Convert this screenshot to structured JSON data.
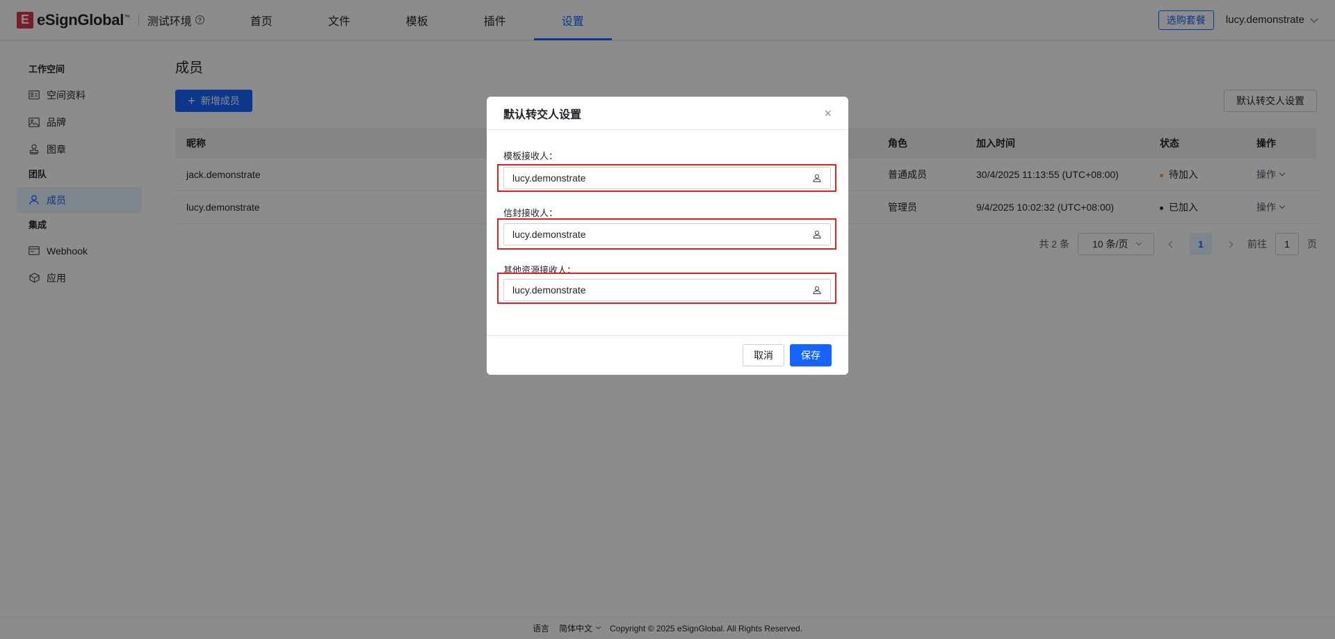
{
  "header": {
    "logo_mark": "E",
    "logo_text": "eSignGlobal",
    "logo_tm": "™",
    "env_label": "测试环境",
    "nav": [
      {
        "label": "首页",
        "active": false
      },
      {
        "label": "文件",
        "active": false
      },
      {
        "label": "模板",
        "active": false
      },
      {
        "label": "插件",
        "active": false
      },
      {
        "label": "设置",
        "active": true
      }
    ],
    "buy_label": "选购套餐",
    "user_name": "lucy.demonstrate"
  },
  "sidebar": {
    "groups": [
      {
        "title": "工作空间",
        "items": [
          {
            "label": "空间资料",
            "icon": "id-card-icon"
          },
          {
            "label": "品牌",
            "icon": "image-icon"
          },
          {
            "label": "图章",
            "icon": "stamp-icon"
          }
        ]
      },
      {
        "title": "团队",
        "items": [
          {
            "label": "成员",
            "icon": "user-icon",
            "active": true
          }
        ]
      },
      {
        "title": "集成",
        "items": [
          {
            "label": "Webhook",
            "icon": "webhook-icon"
          },
          {
            "label": "应用",
            "icon": "cube-icon"
          }
        ]
      }
    ]
  },
  "main": {
    "title": "成员",
    "add_label": "新增成员",
    "transfer_label": "默认转交人设置",
    "columns": {
      "name": "昵称",
      "role": "角色",
      "joined": "加入时间",
      "status": "状态",
      "action": "操作"
    },
    "rows": [
      {
        "name": "jack.demonstrate",
        "role": "普通成员",
        "joined": "30/4/2025 11:13:55 (UTC+08:00)",
        "status": "待加入",
        "status_color": "#ff9a2e",
        "action": "操作"
      },
      {
        "name": "lucy.demonstrate",
        "role": "管理员",
        "joined": "9/4/2025 10:02:32 (UTC+08:00)",
        "status": "已加入",
        "status_color": "#1f2329",
        "action": "操作"
      }
    ],
    "pager": {
      "total": "共 2 条",
      "size": "10 条/页",
      "current": "1",
      "goto_label": "前往",
      "goto_value": "1",
      "page_suffix": "页"
    }
  },
  "modal": {
    "title": "默认转交人设置",
    "fields": [
      {
        "label": "模板接收人：",
        "value": "lucy.demonstrate"
      },
      {
        "label": "信封接收人：",
        "value": "lucy.demonstrate"
      },
      {
        "label": "其他资源接收人：",
        "value": "lucy.demonstrate"
      }
    ],
    "cancel_label": "取消",
    "save_label": "保存"
  },
  "footer": {
    "lang_label": "语言",
    "lang_value": "简体中文",
    "copyright": "Copyright © 2025 eSignGlobal. All Rights Reserved."
  },
  "colors": {
    "primary": "#1664ff",
    "brand": "#e0334e",
    "highlight": "#e02020"
  }
}
